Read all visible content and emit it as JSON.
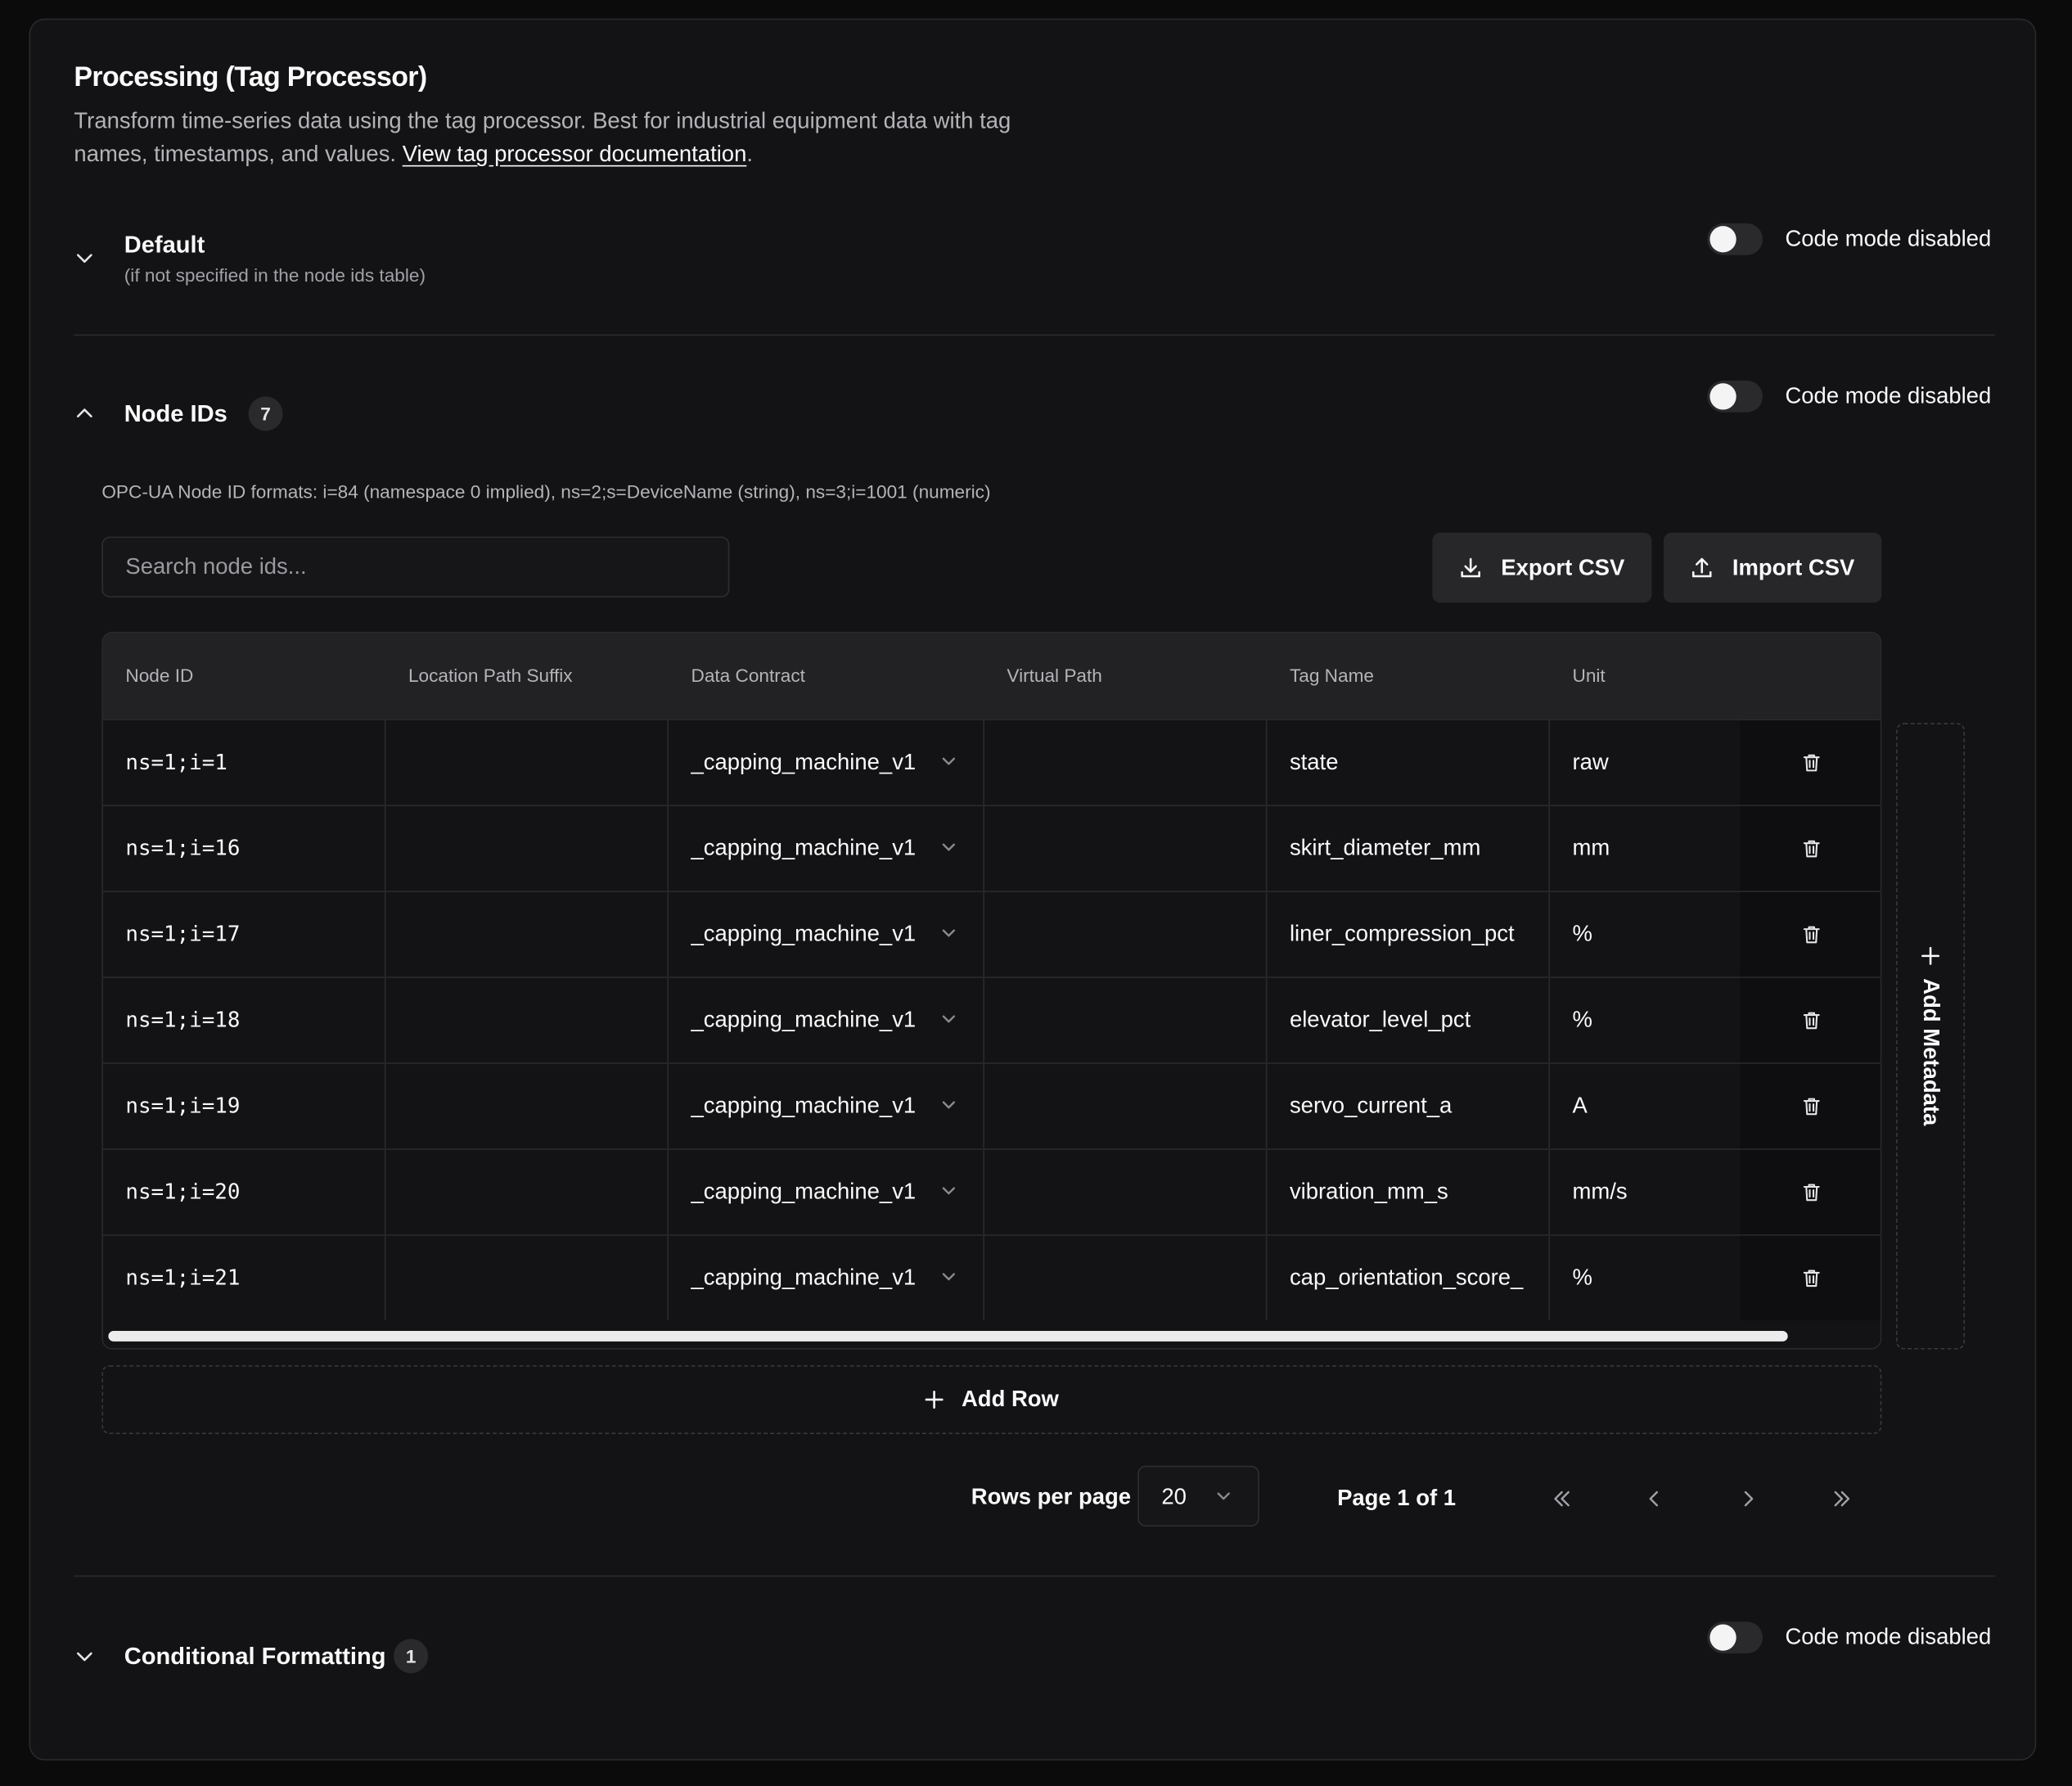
{
  "header": {
    "title": "Processing (Tag Processor)",
    "description": "Transform time-series data using the tag processor. Best for industrial equipment data with tag names, timestamps, and values.",
    "doc_link": "View tag processor documentation",
    "doc_suffix": "."
  },
  "default_section": {
    "title": "Default",
    "subtitle": "(if not specified in the node ids table)",
    "code_mode_label": "Code mode disabled"
  },
  "node_ids_section": {
    "title": "Node IDs",
    "count": "7",
    "code_mode_label": "Code mode disabled",
    "formats_hint": "OPC-UA Node ID formats: i=84 (namespace 0 implied), ns=2;s=DeviceName (string), ns=3;i=1001 (numeric)",
    "search_placeholder": "Search node ids...",
    "export_label": "Export CSV",
    "import_label": "Import CSV",
    "add_metadata_label": "Add Metadata",
    "add_row_label": "Add Row"
  },
  "table": {
    "columns": [
      "Node ID",
      "Location Path Suffix",
      "Data Contract",
      "Virtual Path",
      "Tag Name",
      "Unit"
    ],
    "rows": [
      {
        "node_id": "ns=1;i=1",
        "location": "",
        "contract": "_capping_machine_v1",
        "virtual_path": "",
        "tag": "state",
        "unit": "raw"
      },
      {
        "node_id": "ns=1;i=16",
        "location": "",
        "contract": "_capping_machine_v1",
        "virtual_path": "",
        "tag": "skirt_diameter_mm",
        "unit": "mm"
      },
      {
        "node_id": "ns=1;i=17",
        "location": "",
        "contract": "_capping_machine_v1",
        "virtual_path": "",
        "tag": "liner_compression_pct",
        "unit": "%"
      },
      {
        "node_id": "ns=1;i=18",
        "location": "",
        "contract": "_capping_machine_v1",
        "virtual_path": "",
        "tag": "elevator_level_pct",
        "unit": "%"
      },
      {
        "node_id": "ns=1;i=19",
        "location": "",
        "contract": "_capping_machine_v1",
        "virtual_path": "",
        "tag": "servo_current_a",
        "unit": "A"
      },
      {
        "node_id": "ns=1;i=20",
        "location": "",
        "contract": "_capping_machine_v1",
        "virtual_path": "",
        "tag": "vibration_mm_s",
        "unit": "mm/s"
      },
      {
        "node_id": "ns=1;i=21",
        "location": "",
        "contract": "_capping_machine_v1",
        "virtual_path": "",
        "tag": "cap_orientation_score_",
        "unit": "%"
      }
    ]
  },
  "pagination": {
    "rows_per_page_label": "Rows per page",
    "rows_per_page_value": "20",
    "page_label": "Page 1 of 1"
  },
  "conditional_section": {
    "title": "Conditional Formatting",
    "count": "1",
    "code_mode_label": "Code mode disabled"
  },
  "icons": {
    "collapse": "chevron-down-icon",
    "expand": "chevron-up-icon",
    "export": "download-icon",
    "import": "upload-icon",
    "delete": "trash-icon",
    "add": "plus-icon"
  }
}
